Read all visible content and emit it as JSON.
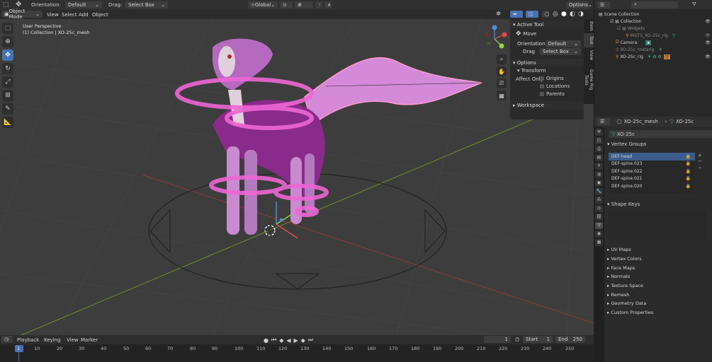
{
  "header": {
    "orientation_label": "Orientation:",
    "orientation_value": "Default",
    "drag_label": "Drag:",
    "drag_value": "Select Box",
    "transform_space": "Global",
    "options_label": "Options"
  },
  "viewport_header": {
    "mode": "Object Mode",
    "menus": [
      "View",
      "Select",
      "Add",
      "Object"
    ]
  },
  "viewport": {
    "perspective": "User Perspective",
    "context": "(1) Collection | XO-25c_mesh"
  },
  "npanel": {
    "active_tool_title": "Active Tool",
    "tool_name": "Move",
    "orientation_label": "Orientation",
    "orientation_value": "Default",
    "drag_label": "Drag",
    "drag_value": "Select Box",
    "options_title": "Options",
    "transform_title": "Transform",
    "affect_only_label": "Affect Only",
    "affect_items": [
      "Origins",
      "Locations",
      "Parents"
    ],
    "workspace_title": "Workspace",
    "tabs": [
      "Item",
      "Tool",
      "View",
      "Game Rig Tools"
    ]
  },
  "outliner": {
    "items": [
      "Scene Collection",
      "Collection",
      "Widgets",
      "WGTS_XO-25c_rig",
      "Camera",
      "XO-25c_matarig",
      "XO-25c_rig"
    ]
  },
  "properties": {
    "object_name": "XO-25c_mesh",
    "data_name": "XO-25c",
    "mesh_field": "XO-25c",
    "vertex_groups_title": "Vertex Groups",
    "vertex_groups": [
      "DEF-head",
      "DEF-spine.023",
      "DEF-spine.022",
      "DEF-spine.021",
      "DEF-spine.020"
    ],
    "shape_keys_title": "Shape Keys",
    "panels": [
      "UV Maps",
      "Vertex Colors",
      "Face Maps",
      "Normals",
      "Texture Space",
      "Remesh",
      "Geometry Data",
      "Custom Properties"
    ]
  },
  "timeline": {
    "menus": [
      "Playback",
      "Keying",
      "View",
      "Marker"
    ],
    "current_frame": "1",
    "start_label": "Start",
    "start_value": "1",
    "end_label": "End",
    "end_value": "250",
    "ticks": [
      "1",
      "10",
      "20",
      "30",
      "40",
      "50",
      "60",
      "70",
      "80",
      "90",
      "100",
      "110",
      "120",
      "130",
      "140",
      "150",
      "160",
      "170",
      "180",
      "190",
      "200",
      "210",
      "220",
      "230",
      "240",
      "250"
    ]
  },
  "colors": {
    "accent": "#4772b3",
    "model_pink": "#e060c8",
    "model_purple": "#8a2a8a",
    "grid_bg": "#3d3d3d"
  }
}
